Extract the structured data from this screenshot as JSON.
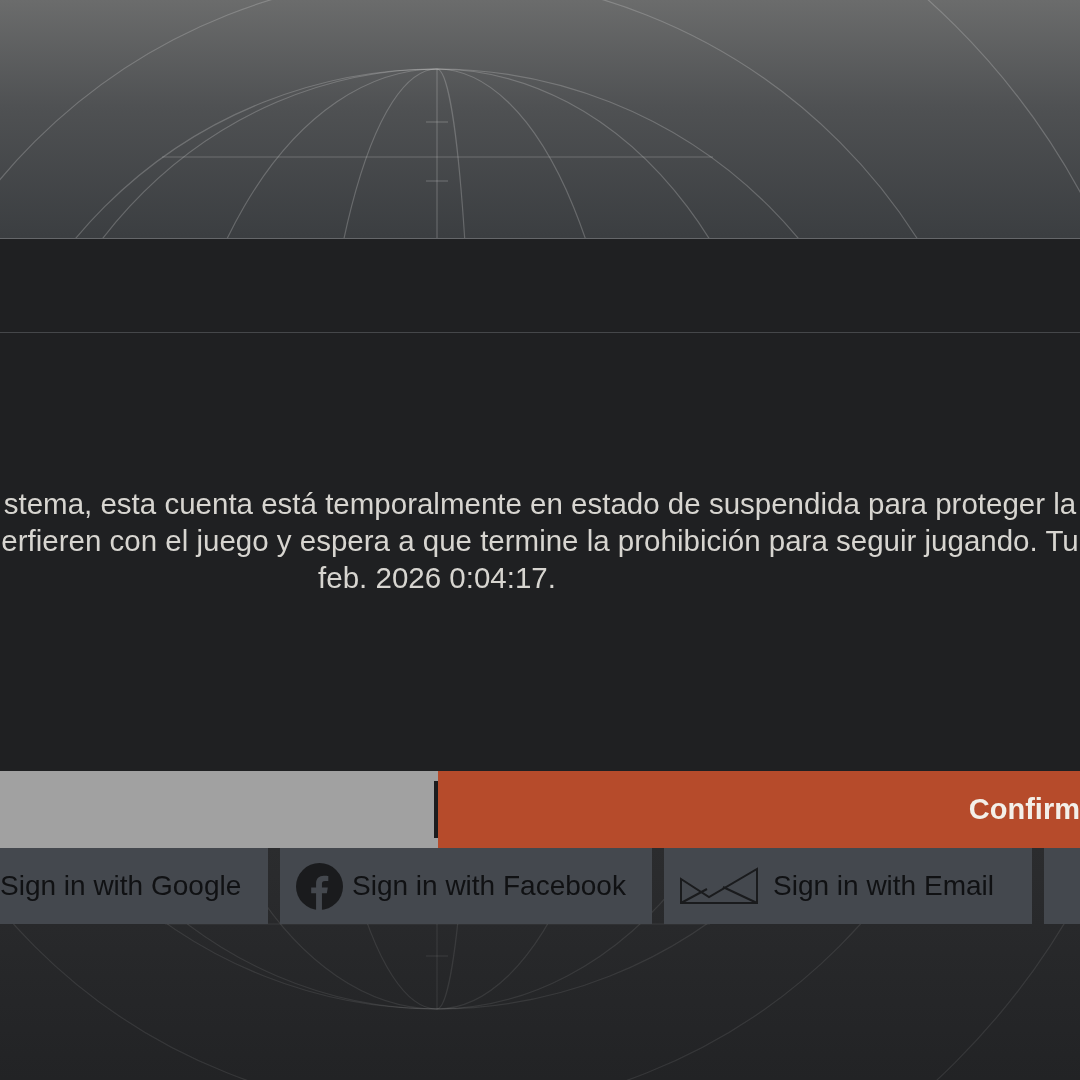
{
  "dialog": {
    "message_lines": [
      "stema, esta cuenta está temporalmente en estado de suspendida para proteger la",
      "erfieren con el juego y espera a que termine la prohibición para seguir jugando. Tu",
      "feb. 2026 0:04:17."
    ],
    "buttons": [
      {
        "kind": "secondary"
      },
      {
        "kind": "primary",
        "label": "Confirm"
      }
    ]
  },
  "sign_in_buttons": [
    {
      "kind": "google",
      "label": "Sign in with Google"
    },
    {
      "kind": "facebook",
      "label": "Sign in with Facebook"
    },
    {
      "kind": "email",
      "label": "Sign in with Email"
    },
    {
      "kind": "blank"
    }
  ]
}
